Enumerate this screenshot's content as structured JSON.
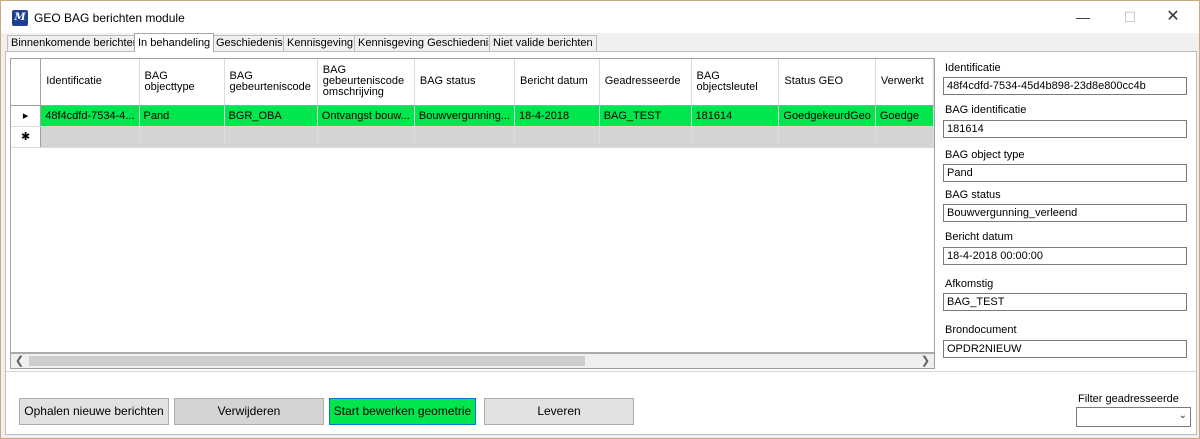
{
  "window": {
    "title": "GEO BAG berichten module",
    "icon": "app-map-icon"
  },
  "tabs": [
    {
      "label": "Binnenkomende berichten",
      "active": false
    },
    {
      "label": "In behandeling",
      "active": true
    },
    {
      "label": "Geschiedenis",
      "active": false
    },
    {
      "label": "Kennisgeving",
      "active": false
    },
    {
      "label": "Kennisgeving Geschiedenis",
      "active": false
    },
    {
      "label": "Niet valide berichten",
      "active": false
    }
  ],
  "grid": {
    "columns": [
      "Identificatie",
      "BAG objecttype",
      "BAG gebeurteniscode",
      "BAG gebeurteniscode omschrijving",
      "BAG status",
      "Bericht datum",
      "Geadresseerde",
      "BAG objectsleutel",
      "Status GEO",
      "Verwerkt"
    ],
    "rows": [
      [
        "48f4cdfd-7534-4...",
        "Pand",
        "BGR_OBA",
        "Ontvangst bouw...",
        "Bouwvergunning...",
        "18-4-2018",
        "BAG_TEST",
        "181614",
        "GoedgekeurdGeo",
        "Goedge"
      ]
    ],
    "row_selected_marker": "▸",
    "new_row_marker": "✱",
    "row_color": "#00e64c"
  },
  "details": {
    "identificatie_label": "Identificatie",
    "identificatie_value": "48f4cdfd-7534-45d4b898-23d8e800cc4b",
    "bag_identificatie_label": "BAG identificatie",
    "bag_identificatie_value": "181614",
    "bag_object_type_label": "BAG object type",
    "bag_object_type_value": "Pand",
    "bag_status_label": "BAG status",
    "bag_status_value": "Bouwvergunning_verleend",
    "bericht_datum_label": "Bericht datum",
    "bericht_datum_value": "18-4-2018 00:00:00",
    "afkomstig_label": "Afkomstig",
    "afkomstig_value": "BAG_TEST",
    "brondocument_label": "Brondocument",
    "brondocument_value": "OPDR2NIEUW"
  },
  "buttons": {
    "ophalen": "Ophalen nieuwe berichten",
    "verwijderen": "Verwijderen",
    "start_bewerken": "Start bewerken geometrie",
    "leveren": "Leveren"
  },
  "filter": {
    "label": "Filter geadresseerde",
    "value": ""
  },
  "colors": {
    "accent_green": "#00e64c",
    "focus_blue": "#0078d7"
  }
}
